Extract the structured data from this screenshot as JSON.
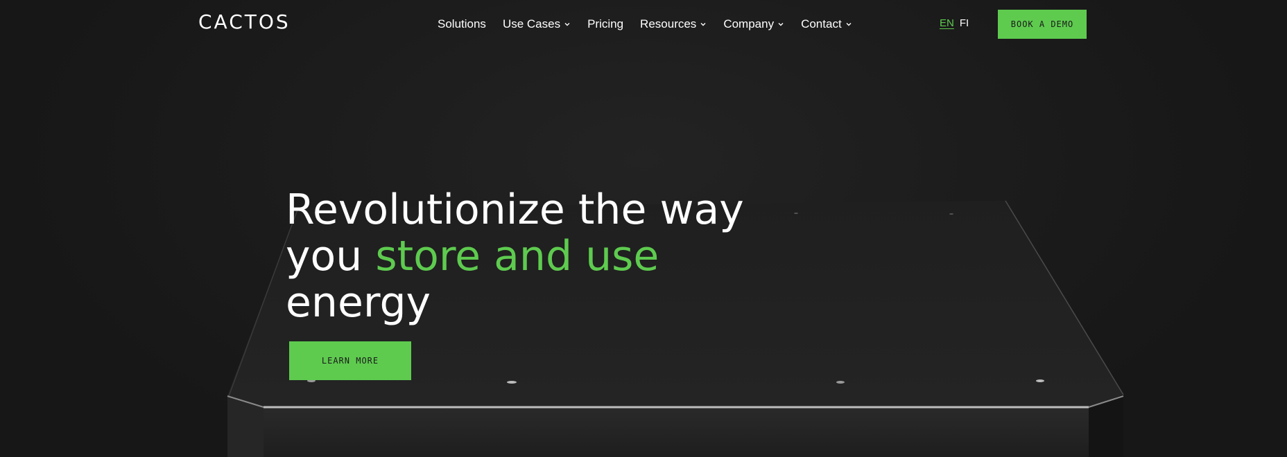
{
  "header": {
    "logo": "CACTOS",
    "nav": [
      {
        "label": "Solutions",
        "has_dropdown": false
      },
      {
        "label": "Use Cases",
        "has_dropdown": true
      },
      {
        "label": "Pricing",
        "has_dropdown": false
      },
      {
        "label": "Resources",
        "has_dropdown": true
      },
      {
        "label": "Company",
        "has_dropdown": true
      },
      {
        "label": "Contact",
        "has_dropdown": true
      }
    ],
    "languages": {
      "active": "EN",
      "other": "FI"
    },
    "cta": "BOOK A DEMO"
  },
  "hero": {
    "headline_part1": "Revolutionize the way",
    "headline_part2": "you ",
    "headline_accent": "store and use",
    "headline_part3": "energy",
    "cta": "LEARN MORE"
  },
  "colors": {
    "accent": "#5ecb4f",
    "background": "#1c1c1c",
    "text": "#ffffff"
  },
  "icons": {
    "dropdown": "chevron-down-icon"
  }
}
